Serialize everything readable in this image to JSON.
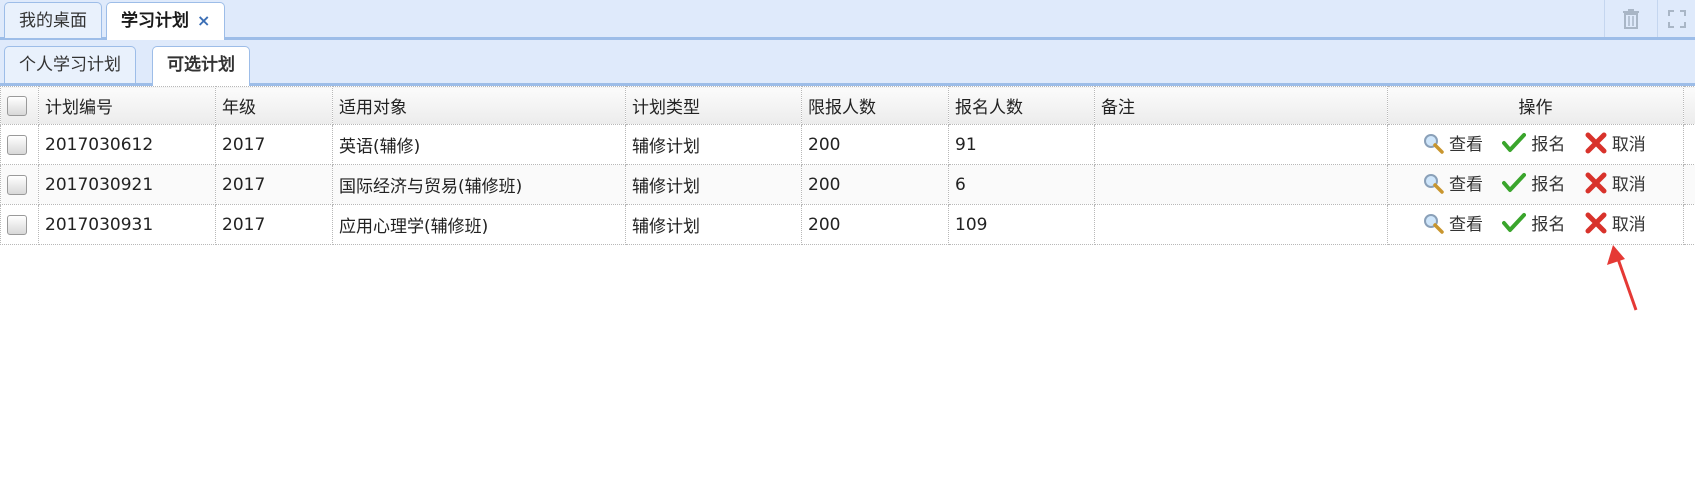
{
  "top_tabs": [
    {
      "label": "我的桌面"
    },
    {
      "label": "学习计划",
      "close": "×"
    }
  ],
  "sub_tabs": [
    {
      "label": "个人学习计划"
    },
    {
      "label": "可选计划"
    }
  ],
  "table": {
    "headers": [
      "计划编号",
      "年级",
      "适用对象",
      "计划类型",
      "限报人数",
      "报名人数",
      "备注",
      "操作"
    ],
    "rows": [
      {
        "id": "2017030612",
        "grade": "2017",
        "target": "英语(辅修)",
        "type": "辅修计划",
        "limit": "200",
        "enrolled": "91",
        "note": ""
      },
      {
        "id": "2017030921",
        "grade": "2017",
        "target": "国际经济与贸易(辅修班)",
        "type": "辅修计划",
        "limit": "200",
        "enrolled": "6",
        "note": ""
      },
      {
        "id": "2017030931",
        "grade": "2017",
        "target": "应用心理学(辅修班)",
        "type": "辅修计划",
        "limit": "200",
        "enrolled": "109",
        "note": ""
      }
    ],
    "actions": {
      "view": "查看",
      "enroll": "报名",
      "cancel": "取消"
    }
  },
  "icons": {
    "trash": "trash-icon",
    "fullscreen": "fullscreen-icon",
    "view": "magnifier-icon",
    "enroll": "check-icon",
    "cancel": "x-icon"
  },
  "colors": {
    "tab_bar": "#dfeafb",
    "tab_border": "#9dbde8",
    "close": "#3c6fb5",
    "check": "#3aa52c",
    "cancel": "#d8322b",
    "arrow": "#e53935"
  }
}
